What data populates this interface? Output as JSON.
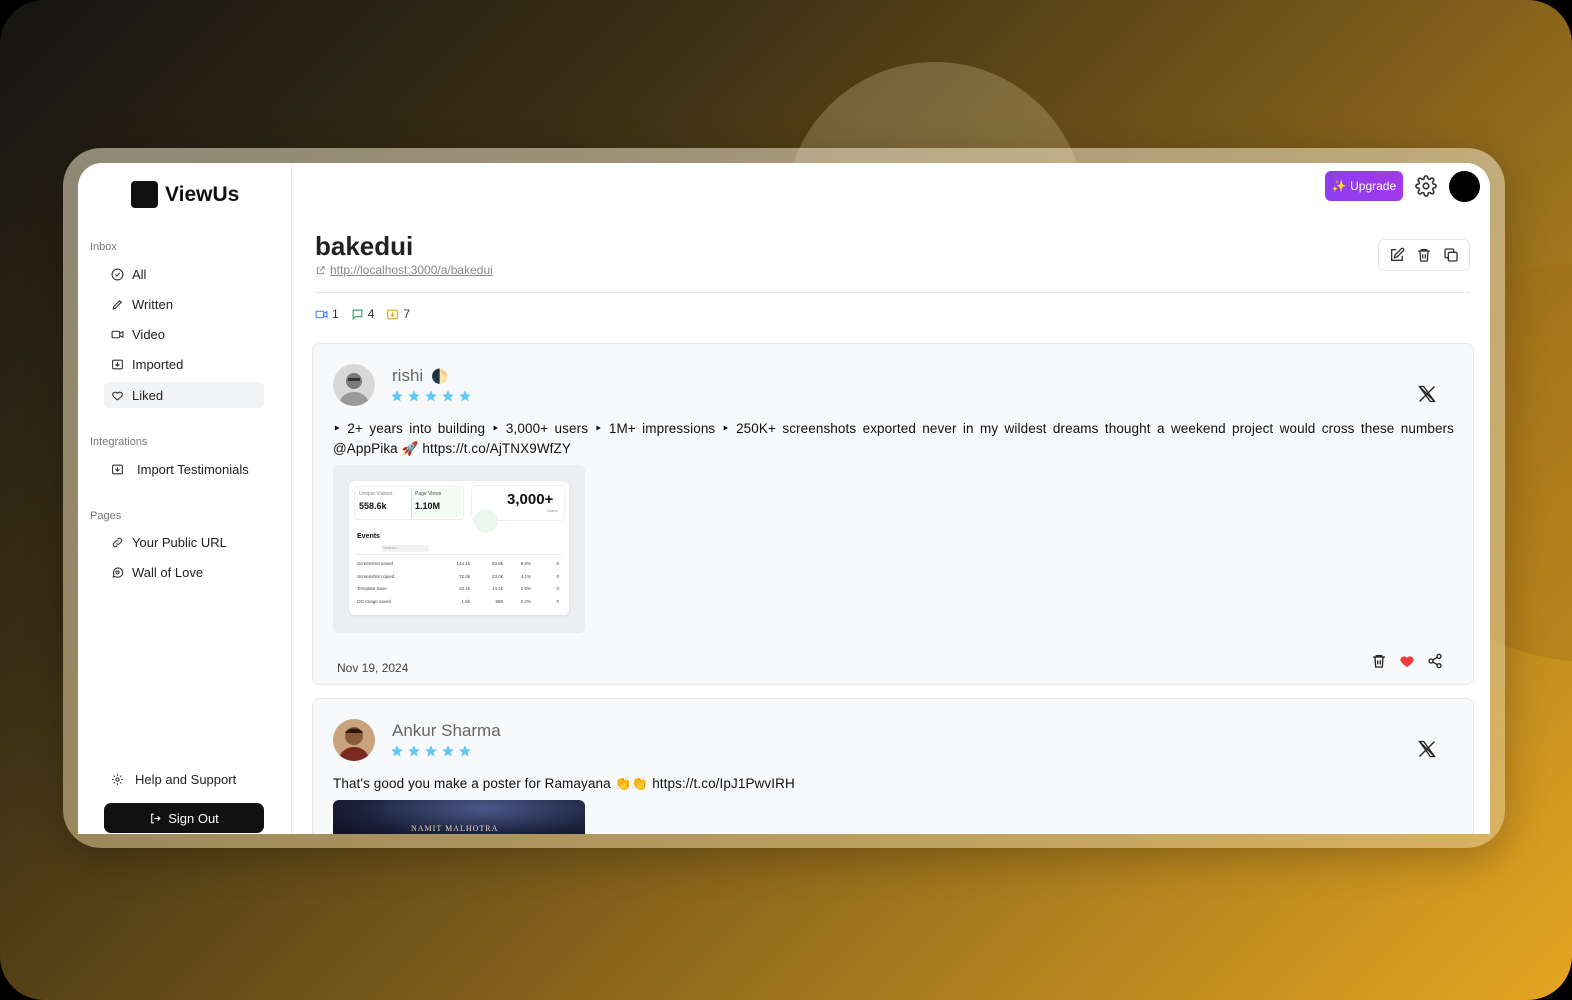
{
  "app": {
    "brand": "ViewUs"
  },
  "sidebar": {
    "inbox_label": "Inbox",
    "inbox_items": [
      {
        "label": "All",
        "icon": "check-circle-icon"
      },
      {
        "label": "Written",
        "icon": "pencil-icon"
      },
      {
        "label": "Video",
        "icon": "video-icon"
      },
      {
        "label": "Imported",
        "icon": "import-icon"
      },
      {
        "label": "Liked",
        "icon": "heart-icon",
        "active": true
      }
    ],
    "integrations_label": "Integrations",
    "integration_items": [
      {
        "label": "Import Testimonials",
        "icon": "import-icon"
      }
    ],
    "pages_label": "Pages",
    "page_items": [
      {
        "label": "Your Public URL",
        "icon": "link-icon"
      },
      {
        "label": "Wall of Love",
        "icon": "message-heart-icon"
      }
    ],
    "help_label": "Help and Support",
    "signout_label": "Sign Out"
  },
  "header": {
    "upgrade_label": "✨ Upgrade"
  },
  "space": {
    "title": "bakedui",
    "url": "http://localhost:3000/a/bakedui",
    "stats": {
      "video": "1",
      "text": "4",
      "imported": "7"
    }
  },
  "testimonials": [
    {
      "name": "rishi",
      "badge": "🌓",
      "rating": 5,
      "source": "x-icon",
      "text": "‣ 2+ years into building ‣ 3,000+ users ‣ 1M+ impressions ‣ 250K+ screenshots exported never in my wildest dreams thought a weekend project would cross these numbers @AppPika 🚀 https://t.co/AjTNX9WfZY",
      "date": "Nov 19, 2024",
      "liked": true,
      "image": {
        "unique_visitors_label": "Unique Visitors",
        "unique_visitors": "558.6k",
        "page_views_label": "Page Views",
        "page_views": "1.10M",
        "users_value": "3,000+",
        "users_label": "Users",
        "events_title": "Events",
        "search_placeholder": "Search...",
        "rows": [
          [
            "Screenshot saved",
            "144.1k",
            "63.8k",
            "9.6%",
            "0"
          ],
          [
            "Screenshot copied",
            "72.3k",
            "23.0k",
            "4.1%",
            "0"
          ],
          [
            "Template Save",
            "33.1k",
            "14.1k",
            "2.5%",
            "0"
          ],
          [
            "OG Image saved",
            "1.6k",
            "888",
            "0.2%",
            "0"
          ]
        ]
      }
    },
    {
      "name": "Ankur Sharma",
      "rating": 5,
      "source": "x-icon",
      "text": "That's good you make a poster for Ramayana 👏👏 https://t.co/IpJ1PwvIRH",
      "image_caption": "NAMIT MALHOTRA"
    }
  ],
  "colors": {
    "accent": "#9b3cf0",
    "star": "#62c9f5",
    "heart": "#ef3b3b"
  }
}
